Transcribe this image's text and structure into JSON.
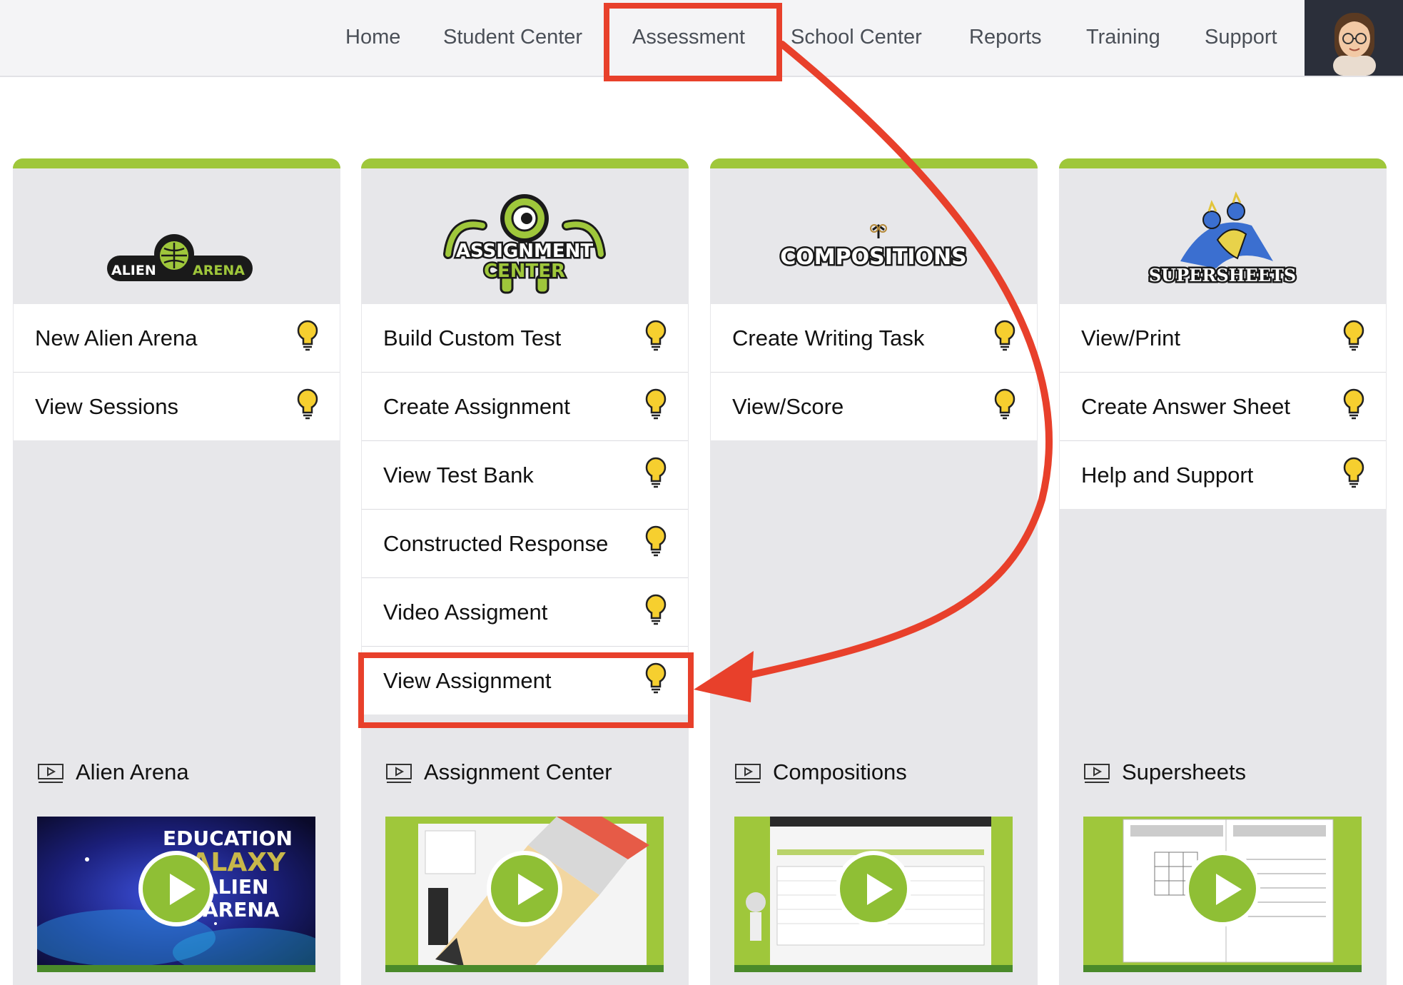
{
  "nav": {
    "items": [
      "Home",
      "Student Center",
      "Assessment",
      "School Center",
      "Reports",
      "Training",
      "Support"
    ],
    "active": "Assessment"
  },
  "cards": [
    {
      "logo_text": [
        "ALIEN",
        "ARENA"
      ],
      "menu": [
        "New Alien Arena",
        "View Sessions"
      ],
      "video_title": "Alien Arena",
      "video_text": [
        "EDUCATION",
        "GALAXY",
        "ALIEN",
        "ARENA"
      ]
    },
    {
      "logo_text": [
        "ASSIGNMENT",
        "CENTER"
      ],
      "menu": [
        "Build Custom Test",
        "Create Assignment",
        "View Test Bank",
        "Constructed Response",
        "Video Assigment",
        "View Assignment"
      ],
      "video_title": "Assignment Center"
    },
    {
      "logo_text": [
        "COMPOSITIONS"
      ],
      "menu": [
        "Create Writing Task",
        "View/Score"
      ],
      "video_title": "Compositions"
    },
    {
      "logo_text": [
        "SUPERSHEETS"
      ],
      "menu": [
        "View/Print",
        "Create Answer Sheet",
        "Help and Support"
      ],
      "video_title": "Supersheets"
    }
  ],
  "colors": {
    "accent_green": "#9fc73b",
    "highlight_red": "#e8402b",
    "bulb_yellow": "#f6cf2f",
    "card_bg": "#e7e7ea"
  },
  "icons": {
    "tip": "lightbulb-icon",
    "video": "video-screen-icon",
    "play": "play-icon"
  }
}
